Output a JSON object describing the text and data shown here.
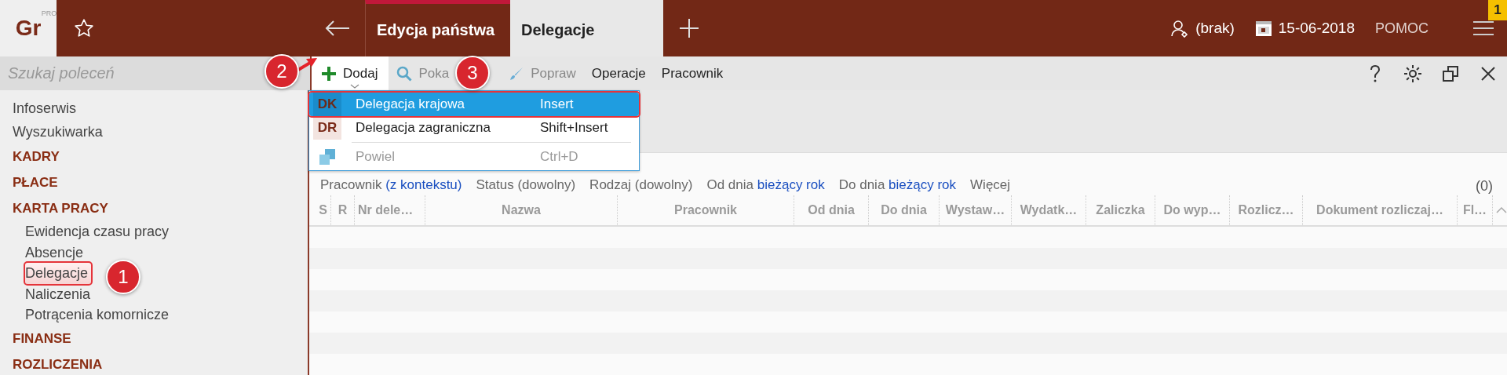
{
  "logo": {
    "text": "Gr",
    "sup": "PRO"
  },
  "tabs": [
    {
      "label": "Edycja państwa",
      "selected": false
    },
    {
      "label": "Delegacje",
      "selected": true
    }
  ],
  "user": {
    "label": "(brak)"
  },
  "date": {
    "label": "15-06-2018"
  },
  "help": {
    "label": "POMOC"
  },
  "notifications": {
    "count": "1"
  },
  "search": {
    "placeholder": "Szukaj poleceń"
  },
  "toolbar": [
    {
      "kind": "add",
      "label": "Dodaj",
      "disabled": false,
      "expanded": true
    },
    {
      "kind": "show",
      "label": "Poka",
      "disabled": true,
      "expanded": false
    },
    {
      "kind": "edit",
      "label": "Popraw",
      "disabled": true,
      "expanded": false
    },
    {
      "kind": "menu",
      "label": "Operacje",
      "disabled": false,
      "expanded": false
    },
    {
      "kind": "menu",
      "label": "Pracownik",
      "disabled": false,
      "expanded": false
    }
  ],
  "sidebar": {
    "items": [
      {
        "kind": "link",
        "label": "Infoserwis"
      },
      {
        "kind": "link",
        "label": "Wyszukiwarka"
      },
      {
        "kind": "section",
        "label": "KADRY"
      },
      {
        "kind": "section",
        "label": "PŁACE"
      },
      {
        "kind": "section",
        "label": "KARTA PRACY",
        "children": [
          {
            "label": "Ewidencja czasu pracy",
            "selected": false
          },
          {
            "label": "Absencje",
            "selected": false
          },
          {
            "label": "Delegacje",
            "selected": true
          },
          {
            "label": "Naliczenia",
            "selected": false
          },
          {
            "label": "Potrącenia komornicze",
            "selected": false
          }
        ]
      },
      {
        "kind": "section",
        "label": "FINANSE"
      },
      {
        "kind": "section",
        "label": "ROZLICZENIA"
      }
    ]
  },
  "dropdown": {
    "items": [
      {
        "kind": "code",
        "code": "DK",
        "label": "Delegacja krajowa",
        "shortcut": "Insert",
        "selected": true,
        "disabled": false
      },
      {
        "kind": "code",
        "code": "DR",
        "label": "Delegacja zagraniczna",
        "shortcut": "Shift+Insert",
        "selected": false,
        "disabled": false
      },
      {
        "kind": "separator"
      },
      {
        "kind": "icon",
        "label": "Powiel",
        "shortcut": "Ctrl+D",
        "selected": false,
        "disabled": true
      }
    ]
  },
  "filters": [
    {
      "label": "Pracownik",
      "value": "(z kontekstu)",
      "kind": "link"
    },
    {
      "label": "Status",
      "value": "(dowolny)",
      "kind": "plain"
    },
    {
      "label": "Rodzaj",
      "value": "(dowolny)",
      "kind": "plain"
    },
    {
      "label": "Od dnia",
      "value": "bieżący rok",
      "kind": "link"
    },
    {
      "label": "Do dnia",
      "value": "bieżący rok",
      "kind": "link"
    },
    {
      "label": "Więcej",
      "kind": "more"
    }
  ],
  "count": "(0)",
  "table": {
    "columns": [
      "S",
      "R",
      "Nr dele…",
      "Nazwa",
      "Pracownik",
      "Od dnia",
      "Do dnia",
      "Wystaw…",
      "Wydatk…",
      "Zaliczka",
      "Do wyp…",
      "Rozlicz…",
      "Dokument rozliczaj…",
      "Fl…"
    ]
  },
  "annotations": [
    {
      "label": "1"
    },
    {
      "label": "2"
    },
    {
      "label": "3"
    }
  ]
}
